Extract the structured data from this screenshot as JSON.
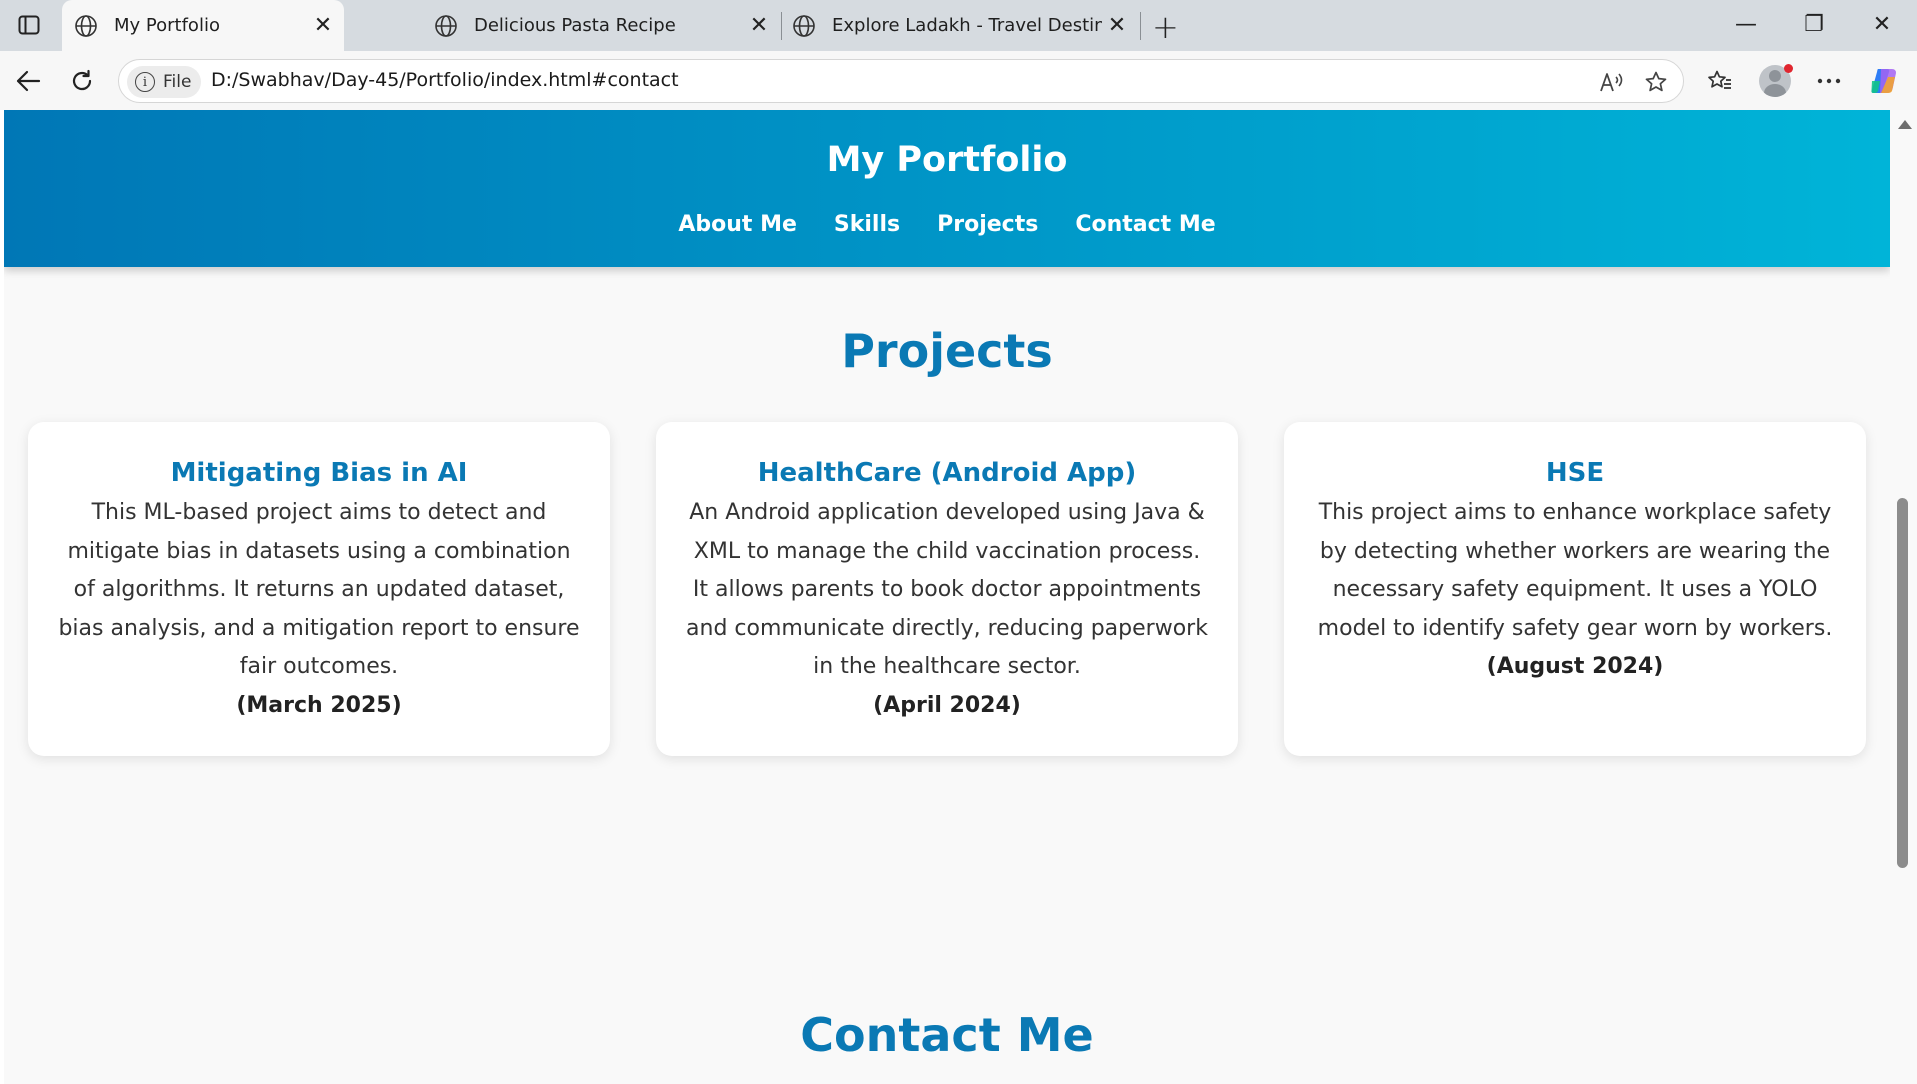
{
  "browser": {
    "tabs": [
      {
        "title": "My Portfolio",
        "active": true
      },
      {
        "title": "Delicious Pasta Recipe",
        "active": false
      },
      {
        "title": "Explore Ladakh - Travel Destinatio",
        "active": false
      }
    ],
    "new_tab_symbol": "+",
    "address_bar": {
      "scheme_label": "File",
      "url": "D:/Swabhav/Day-45/Portfolio/index.html#contact"
    },
    "icons": {
      "back": "back-arrow-icon",
      "refresh": "refresh-icon",
      "read_aloud": "read-aloud-icon",
      "favorite": "star-icon",
      "favorites": "favorites-icon",
      "more": "more-icon",
      "copilot": "copilot-icon"
    },
    "window_controls": {
      "minimize": "—",
      "restore": "❐",
      "close": "✕"
    }
  },
  "site": {
    "title": "My Portfolio",
    "nav": [
      "About Me",
      "Skills",
      "Projects",
      "Contact Me"
    ],
    "colors": {
      "header_start": "#0077b6",
      "header_end": "#00b4d8",
      "accent": "#0a79b4"
    }
  },
  "projects": {
    "heading": "Projects",
    "items": [
      {
        "title": "Mitigating Bias in AI",
        "description": "This ML-based project aims to detect and mitigate bias in datasets using a combination of algorithms. It returns an updated dataset, bias analysis, and a mitigation report to ensure fair outcomes.",
        "date": "(March 2025)"
      },
      {
        "title": "HealthCare (Android App)",
        "description": "An Android application developed using Java & XML to manage the child vaccination process. It allows parents to book doctor appointments and communicate directly, reducing paperwork in the healthcare sector.",
        "date": "(April 2024)"
      },
      {
        "title": "HSE",
        "description": "This project aims to enhance workplace safety by detecting whether workers are wearing the necessary safety equipment. It uses a YOLO model to identify safety gear worn by workers.",
        "date": "(August 2024)"
      }
    ]
  },
  "contact": {
    "heading": "Contact Me"
  }
}
